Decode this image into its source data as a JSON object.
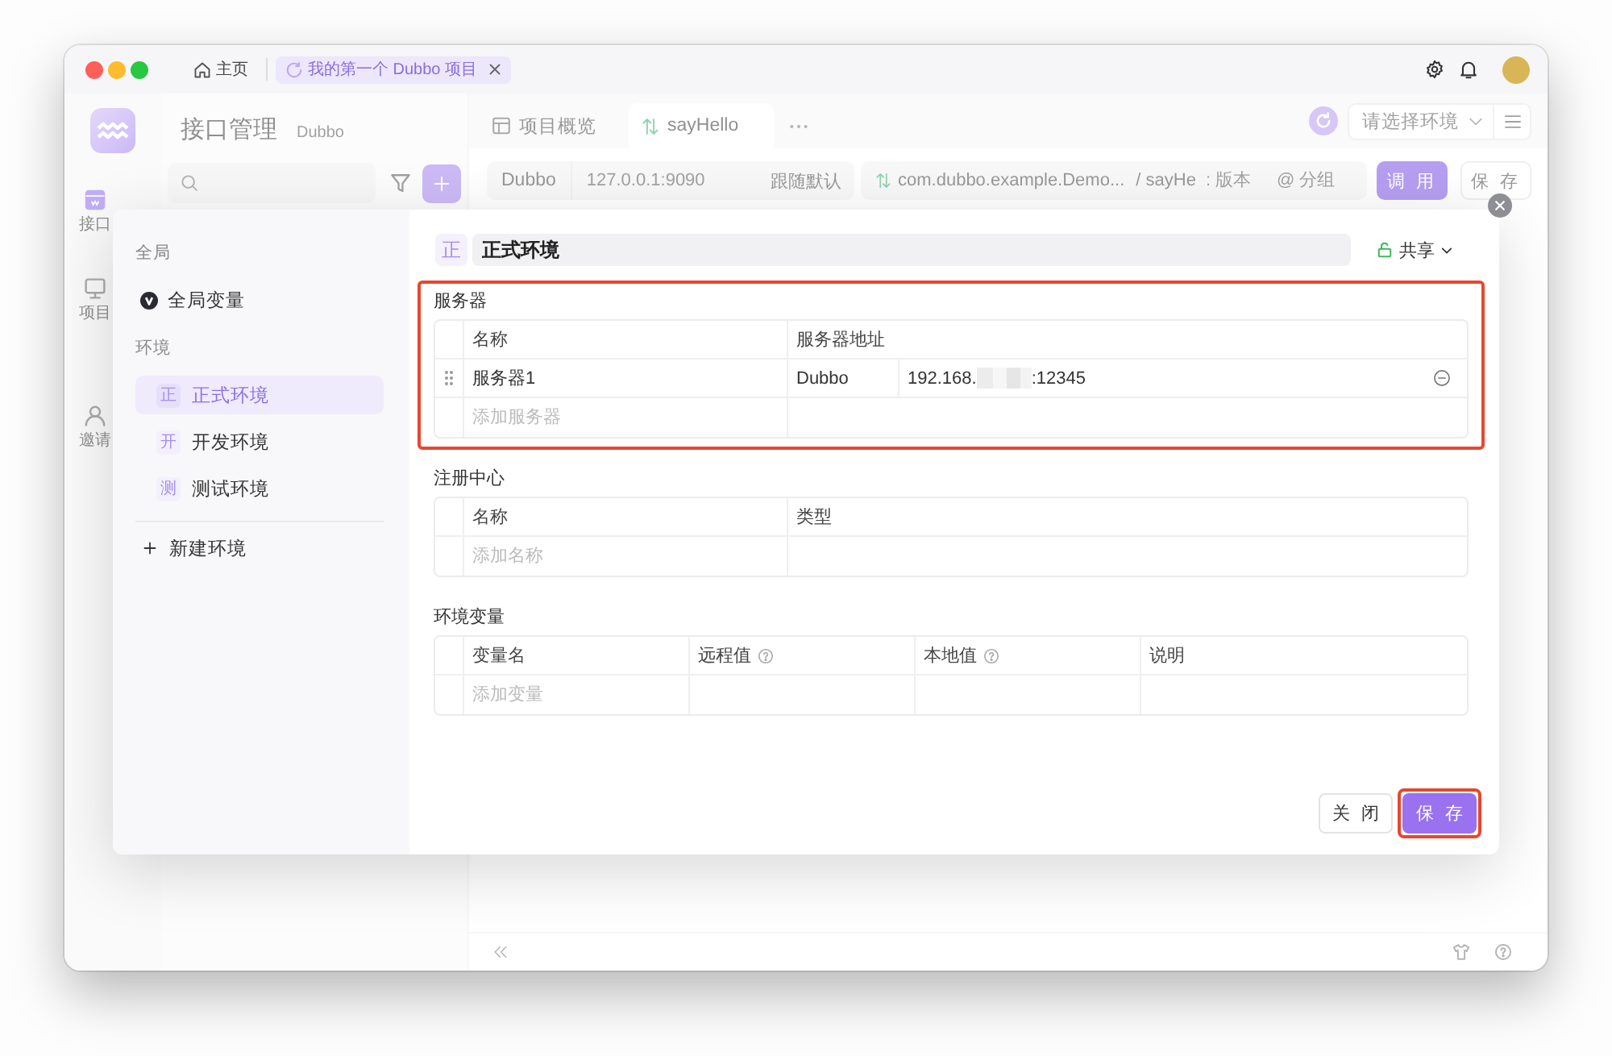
{
  "title_bar": {
    "tabs": [
      {
        "kind": "home",
        "label": "主页",
        "selected": false,
        "closable": false
      },
      {
        "kind": "project",
        "label": "我的第一个 Dubbo 项目",
        "selected": true,
        "closable": true
      }
    ]
  },
  "nav_rail": {
    "items": [
      {
        "kind": "api",
        "label": "接口",
        "selected": true
      },
      {
        "kind": "project",
        "label": "项目",
        "selected": false
      },
      {
        "kind": "invite",
        "label": "邀请",
        "selected": false
      }
    ]
  },
  "api_panel": {
    "title": "接口管理",
    "subtitle": "Dubbo"
  },
  "main": {
    "tabs": [
      {
        "kind": "overview",
        "label": "项目概览",
        "selected": false
      },
      {
        "kind": "method",
        "label": "sayHello",
        "selected": true
      }
    ],
    "environment_select": {
      "placeholder": "请选择环境"
    },
    "request_bar": {
      "protocol": "Dubbo",
      "address": {
        "placeholder": "127.0.0.1:9090"
      },
      "mode": "跟随默认",
      "service": "com.dubbo.example.Demo...",
      "method": "/ sayHe",
      "version": {
        "placeholder": ": 版本"
      },
      "group": {
        "placeholder": "@ 分组"
      },
      "buttons": [
        {
          "kind": "primary",
          "label": "调 用"
        },
        {
          "kind": "default",
          "label": "保 存"
        }
      ]
    }
  },
  "dialog": {
    "sidebar": {
      "sections": [
        {
          "title": "全局",
          "items": [
            {
              "kind": "global",
              "label": "全局变量",
              "selected": false
            }
          ]
        },
        {
          "title": "环境",
          "items": [
            {
              "kind": "environment",
              "badge": "正",
              "label": "正式环境",
              "selected": true
            },
            {
              "kind": "environment",
              "badge": "开",
              "label": "开发环境",
              "selected": false
            },
            {
              "kind": "environment",
              "badge": "测",
              "label": "测试环境",
              "selected": false
            }
          ]
        }
      ],
      "add_label": "新建环境"
    },
    "header": {
      "badge": "正",
      "name": "正式环境",
      "share": "共享"
    },
    "sections": [
      {
        "kind": "servers",
        "title": "服务器",
        "highlighted": true,
        "columns": [
          {
            "label": "名称",
            "help": false
          },
          {
            "label": "服务器地址",
            "help": false
          }
        ],
        "rows": [
          {
            "name": "服务器1",
            "protocol": "Dubbo",
            "address_start": "192.168.",
            "address_end": ":12345",
            "redacted": true
          }
        ],
        "add_row": {
          "placeholder": "添加服务器"
        }
      },
      {
        "kind": "registry",
        "title": "注册中心",
        "highlighted": false,
        "columns": [
          {
            "label": "名称",
            "help": false
          },
          {
            "label": "类型",
            "help": false
          }
        ],
        "add_row": {
          "placeholder": "添加名称"
        }
      },
      {
        "kind": "variables",
        "title": "环境变量",
        "highlighted": false,
        "columns": [
          {
            "label": "变量名",
            "help": false
          },
          {
            "label": "远程值",
            "help": true
          },
          {
            "label": "本地值",
            "help": true
          },
          {
            "label": "说明",
            "help": false
          }
        ],
        "add_row": {
          "placeholder": "添加变量"
        }
      }
    ],
    "buttons": [
      {
        "kind": "default",
        "label": "关 闭",
        "highlighted": false
      },
      {
        "kind": "primary",
        "label": "保 存",
        "highlighted": true
      }
    ]
  }
}
